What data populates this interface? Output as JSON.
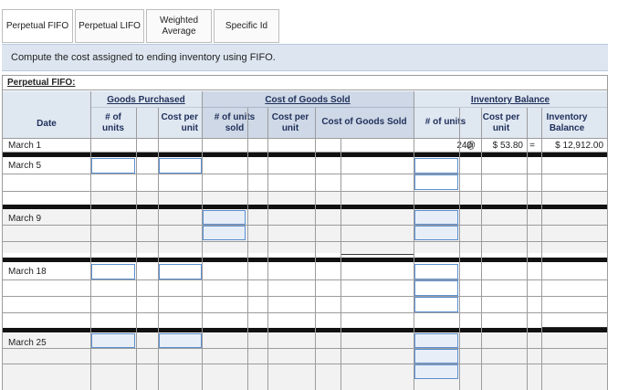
{
  "tabs": [
    {
      "label": "Perpetual FIFO"
    },
    {
      "label": "Perpetual LIFO"
    },
    {
      "label": "Weighted Average"
    },
    {
      "label": "Specific Id"
    }
  ],
  "instruction": "Compute the cost assigned to ending inventory using FIFO.",
  "sheet_title": "Perpetual FIFO:",
  "headers": {
    "date": "Date",
    "goods_purchased": "Goods Purchased",
    "gp_units": "# of units",
    "gp_cost": "Cost per unit",
    "cogs_group": "Cost of Goods Sold",
    "cogs_units": "# of units sold",
    "cogs_cost": "Cost per unit",
    "cogs_total": "Cost of Goods Sold",
    "inventory_balance": "Inventory Balance",
    "inv_units": "# of units",
    "inv_cost": "Cost per unit",
    "inv_balance": "Inventory Balance"
  },
  "rows": {
    "march1": {
      "date": "March 1",
      "units": "240",
      "at": "@",
      "cost": "$ 53.80",
      "eq": "=",
      "balance": "$ 12,912.00"
    },
    "march5": {
      "date": "March 5"
    },
    "march9": {
      "date": "March 9"
    },
    "march18": {
      "date": "March 18"
    },
    "march25": {
      "date": "March 25"
    }
  }
}
